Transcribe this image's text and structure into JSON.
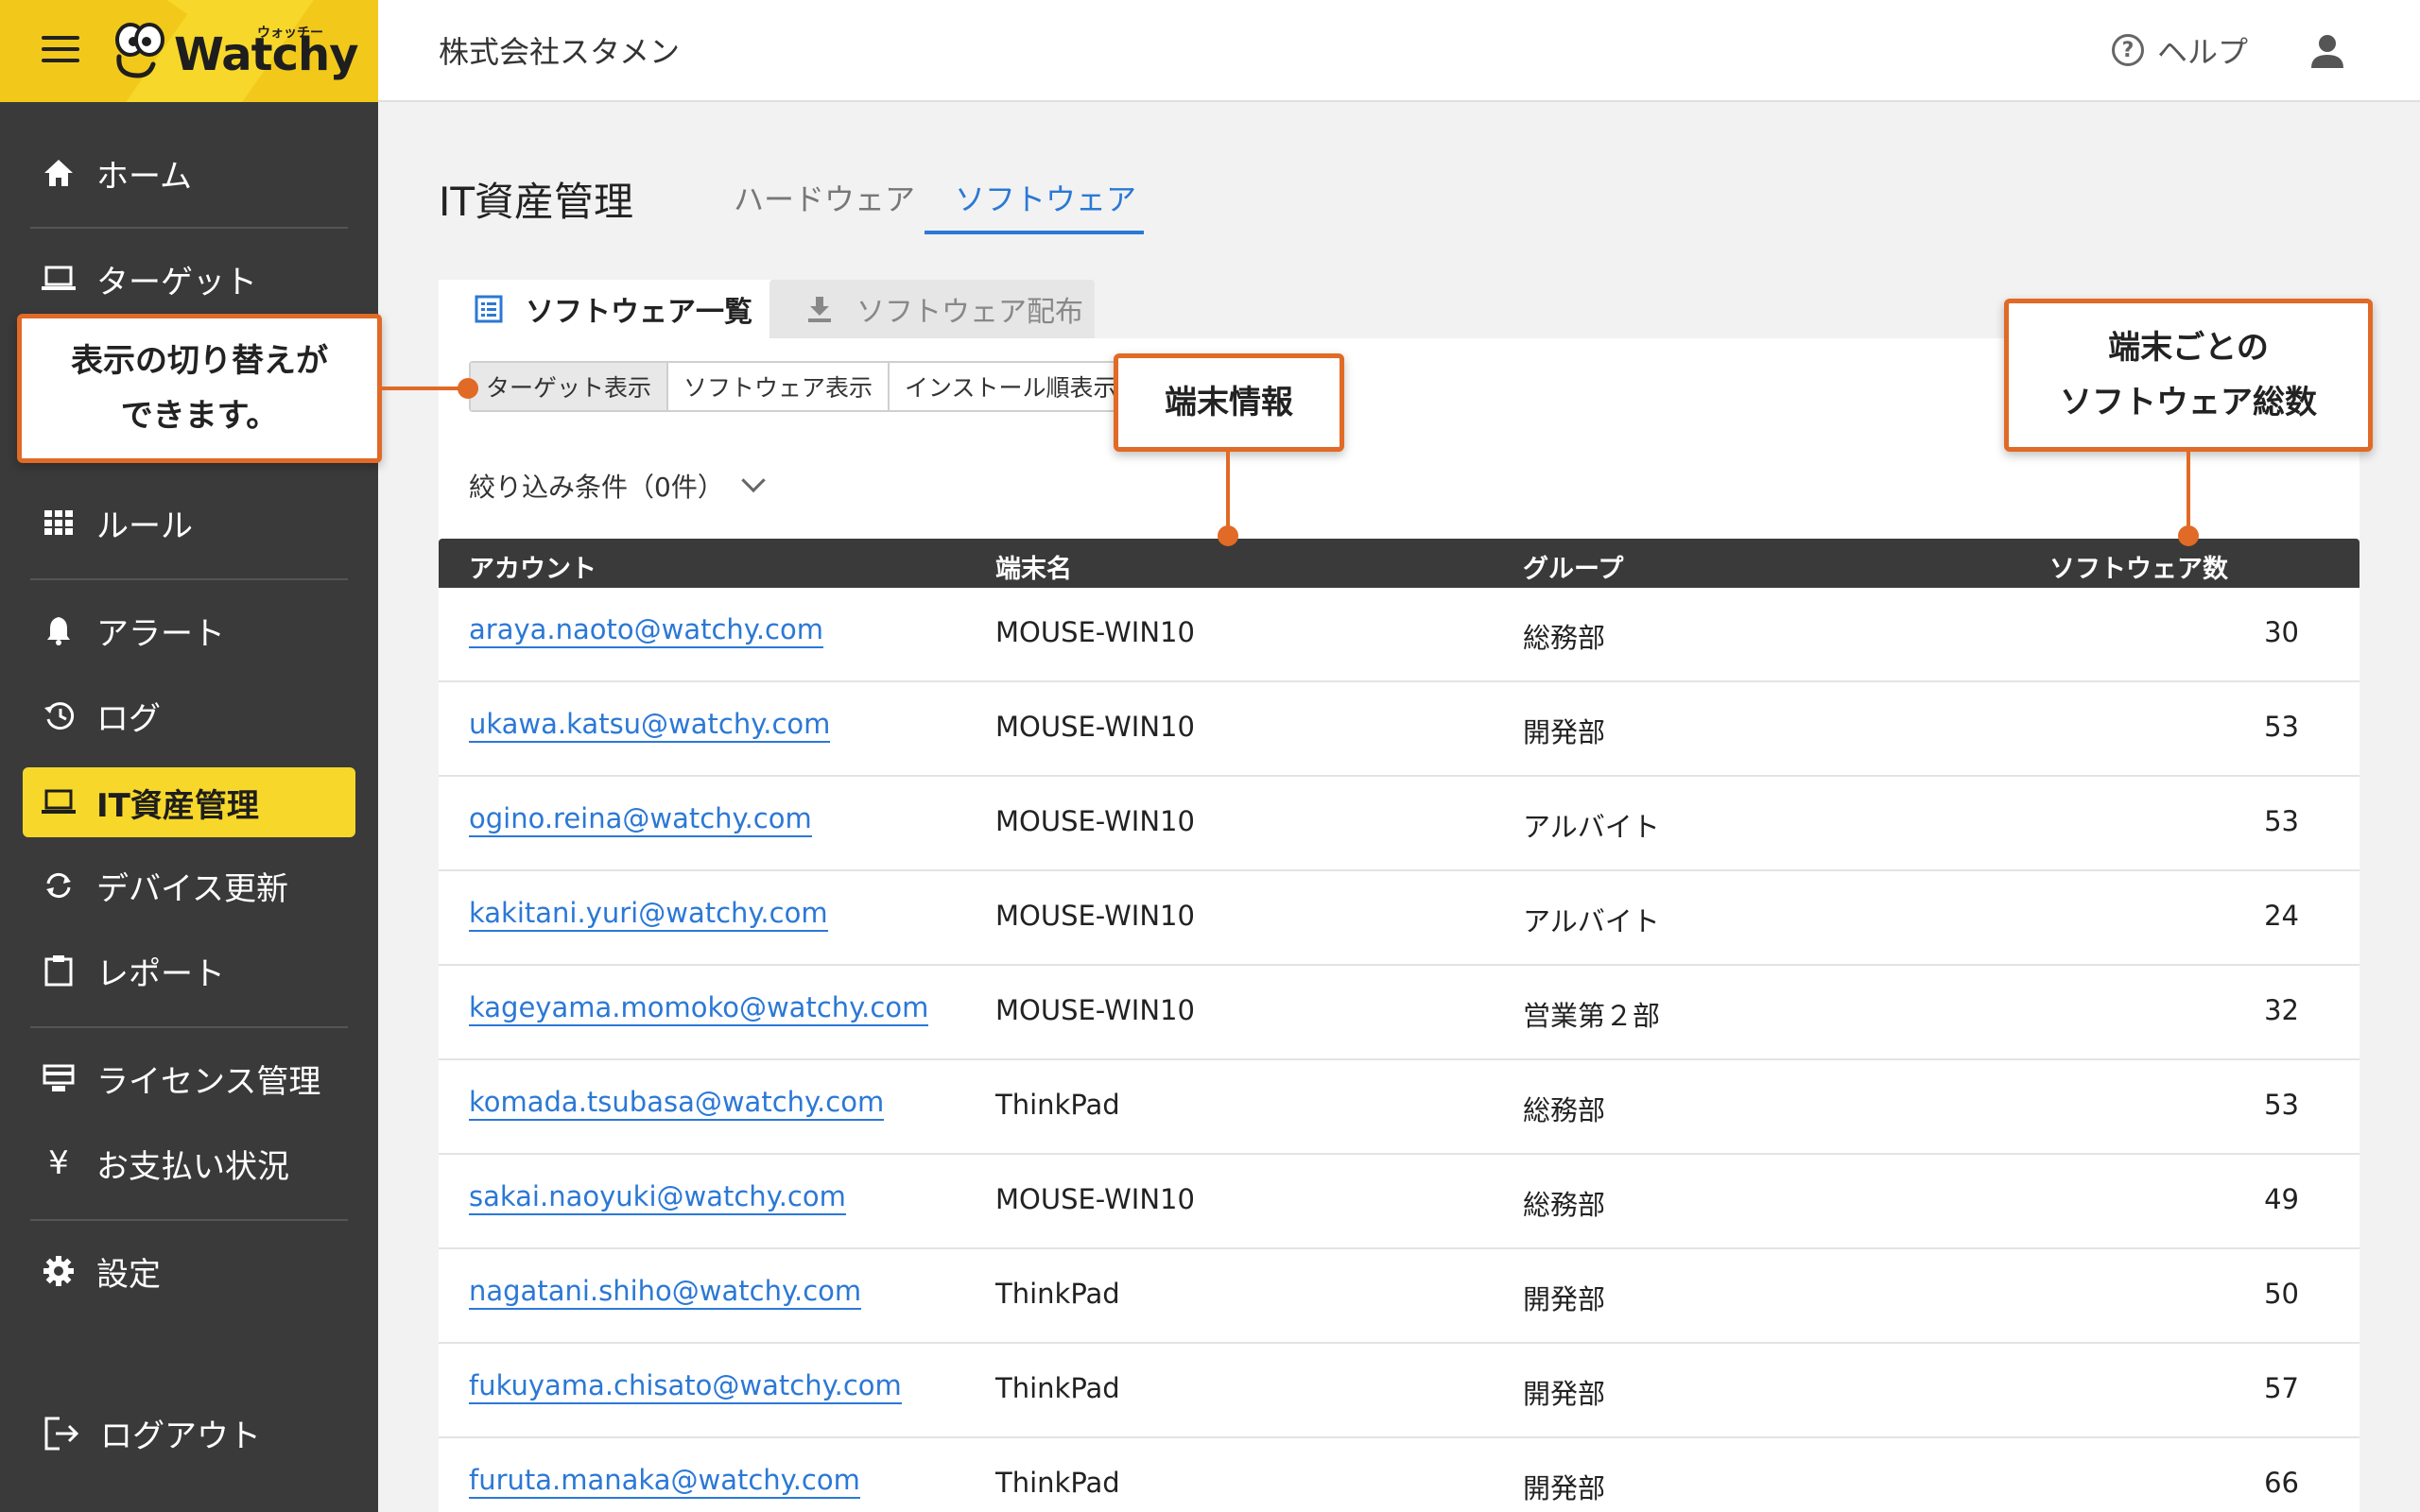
{
  "brand": {
    "name": "Watchy",
    "kana": "ウォッチー"
  },
  "sidebar": {
    "items": [
      {
        "label": "ホーム",
        "icon": "home-icon"
      },
      {
        "label": "ターゲット",
        "icon": "laptop-icon"
      },
      {
        "label": "ルール",
        "icon": "grid-icon"
      },
      {
        "label": "アラート",
        "icon": "bell-icon"
      },
      {
        "label": "ログ",
        "icon": "history-icon"
      },
      {
        "label": "IT資産管理",
        "icon": "laptop-icon",
        "active": true
      },
      {
        "label": "デバイス更新",
        "icon": "sync-icon"
      },
      {
        "label": "レポート",
        "icon": "clipboard-icon"
      },
      {
        "label": "ライセンス管理",
        "icon": "license-icon"
      },
      {
        "label": "お支払い状況",
        "icon": "yen-icon"
      },
      {
        "label": "設定",
        "icon": "gear-icon"
      }
    ],
    "logout": "ログアウト",
    "yen_glyph": "¥"
  },
  "header": {
    "company": "株式会社スタメン",
    "help": "ヘルプ",
    "help_glyph": "?"
  },
  "page": {
    "title": "IT資産管理",
    "tabs": [
      {
        "label": "ハードウェア"
      },
      {
        "label": "ソフトウェア",
        "active": true
      }
    ],
    "subtabs": [
      {
        "label": "ソフトウェア一覧",
        "active": true
      },
      {
        "label": "ソフトウェア配布"
      }
    ],
    "view_toggle": [
      {
        "label": "ターゲット表示",
        "active": true
      },
      {
        "label": "ソフトウェア表示"
      },
      {
        "label": "インストール順表示"
      }
    ],
    "filter": "絞り込み条件（0件）"
  },
  "table": {
    "columns": [
      "アカウント",
      "端末名",
      "グループ",
      "ソフトウェア数"
    ],
    "rows": [
      [
        "araya.naoto@watchy.com",
        "MOUSE-WIN10",
        "総務部",
        "30"
      ],
      [
        "ukawa.katsu@watchy.com",
        "MOUSE-WIN10",
        "開発部",
        "53"
      ],
      [
        "ogino.reina@watchy.com",
        "MOUSE-WIN10",
        "アルバイト",
        "53"
      ],
      [
        "kakitani.yuri@watchy.com",
        "MOUSE-WIN10",
        "アルバイト",
        "24"
      ],
      [
        "kageyama.momoko@watchy.com",
        "MOUSE-WIN10",
        "営業第２部",
        "32"
      ],
      [
        "komada.tsubasa@watchy.com",
        "ThinkPad",
        "総務部",
        "53"
      ],
      [
        "sakai.naoyuki@watchy.com",
        "MOUSE-WIN10",
        "総務部",
        "49"
      ],
      [
        "nagatani.shiho@watchy.com",
        "ThinkPad",
        "開発部",
        "50"
      ],
      [
        "fukuyama.chisato@watchy.com",
        "ThinkPad",
        "開発部",
        "57"
      ],
      [
        "furuta.manaka@watchy.com",
        "ThinkPad",
        "開発部",
        "66"
      ]
    ]
  },
  "callouts": {
    "toggle": [
      "表示の切り替えが",
      "できます。"
    ],
    "device": [
      "端末情報"
    ],
    "count": [
      "端末ごとの",
      "ソフトウェア総数"
    ]
  },
  "colors": {
    "brand_yellow": "#f7d82a",
    "sidebar_bg": "#3a3a3a",
    "link_blue": "#2b78d6",
    "callout_orange": "#e06a26"
  }
}
